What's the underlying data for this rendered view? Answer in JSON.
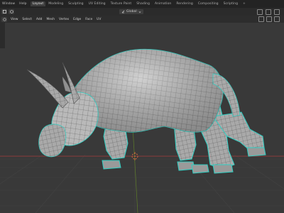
{
  "menu": {
    "items": [
      "Window",
      "Help"
    ]
  },
  "workspace_tabs": [
    "Layout",
    "Modeling",
    "Sculpting",
    "UV Editing",
    "Texture Paint",
    "Shading",
    "Animation",
    "Rendering",
    "Compositing",
    "Scripting"
  ],
  "workspace_add": "+",
  "header": {
    "transform_orientation": "Global"
  },
  "viewport_menu": [
    "View",
    "Select",
    "Add",
    "Mesh",
    "Vertex",
    "Edge",
    "Face",
    "UV"
  ],
  "colors": {
    "selection_outline": "#2fd0c4",
    "mesh_surface": "#b9b9b9",
    "grid_bg": "#393939",
    "x_axis": "#8a3a3a",
    "y_axis": "#5e7d2a",
    "cursor": "#e07040"
  },
  "icons": {
    "mode": "edit-mode-icon",
    "cursor": "3d-cursor-icon"
  }
}
